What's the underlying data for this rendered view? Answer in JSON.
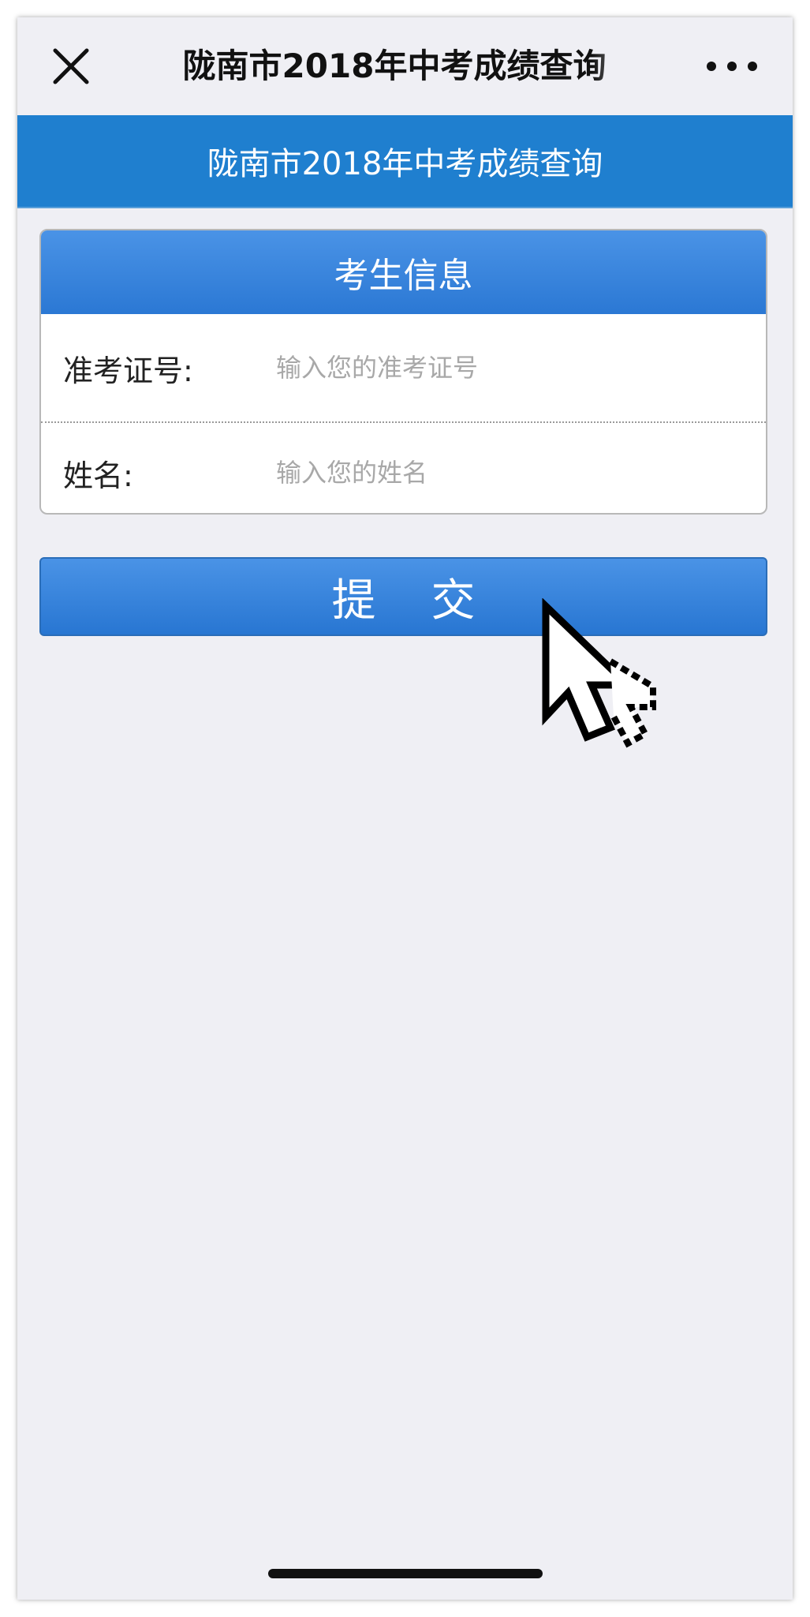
{
  "navbar": {
    "title": "陇南市2018年中考成绩查询",
    "close_icon": "close-icon",
    "more_icon": "more-dots-icon"
  },
  "banner": {
    "title": "陇南市2018年中考成绩查询"
  },
  "panel": {
    "header": "考生信息",
    "fields": [
      {
        "label": "准考证号:",
        "placeholder": "输入您的准考证号",
        "value": ""
      },
      {
        "label": "姓名:",
        "placeholder": "输入您的姓名",
        "value": ""
      }
    ]
  },
  "submit": {
    "label": "提交"
  },
  "colors": {
    "accent": "#1f7fcf",
    "background": "#efeff4"
  }
}
